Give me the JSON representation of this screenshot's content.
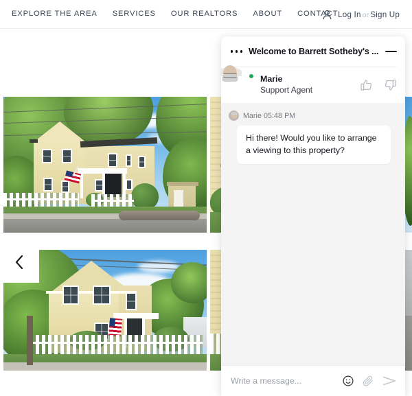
{
  "nav": {
    "links": [
      {
        "label": "EXPLORE THE AREA",
        "name": "nav-explore-the-area"
      },
      {
        "label": "SERVICES",
        "name": "nav-services"
      },
      {
        "label": "OUR REALTORS",
        "name": "nav-our-realtors"
      },
      {
        "label": "ABOUT",
        "name": "nav-about"
      },
      {
        "label": "CONTACT",
        "name": "nav-contact"
      }
    ],
    "account_icon": "person-icon",
    "log_in": "Log In",
    "or": "or",
    "sign_up": "Sign Up"
  },
  "gallery": {
    "prev_arrow_icon": "chevron-left-icon",
    "photos": [
      {
        "alt": "Yellow colonial house with white picket fence and American flag"
      },
      {
        "alt": "Yellow colonial house front view with white picket fence"
      },
      {
        "alt": "Partial property photo"
      },
      {
        "alt": "Partial property photo right edge"
      }
    ]
  },
  "chat": {
    "menu_icon": "more-options-icon",
    "title": "Welcome to Barrett Sotheby's ...",
    "minimize_icon": "minimize-icon",
    "agent": {
      "name": "Marie",
      "role": "Support Agent",
      "avatar_icon": "agent-avatar",
      "status": "online",
      "thumbs_up_icon": "thumbs-up-icon",
      "thumbs_down_icon": "thumbs-down-icon"
    },
    "messages": [
      {
        "sender": "Marie",
        "time": "05:48 PM",
        "meta": "Marie 05:48 PM",
        "text": "Hi there! Would you like to arrange a viewing to this property?"
      }
    ],
    "input": {
      "value": "",
      "placeholder": "Write a message...",
      "emoji_icon": "emoji-icon",
      "attach_icon": "paperclip-icon",
      "send_icon": "send-icon"
    }
  },
  "colors": {
    "accent_green": "#1faa5c",
    "nav_text": "#3d4656",
    "chat_body_bg": "#f4f4f4",
    "bubble_bg": "#ffffff"
  }
}
